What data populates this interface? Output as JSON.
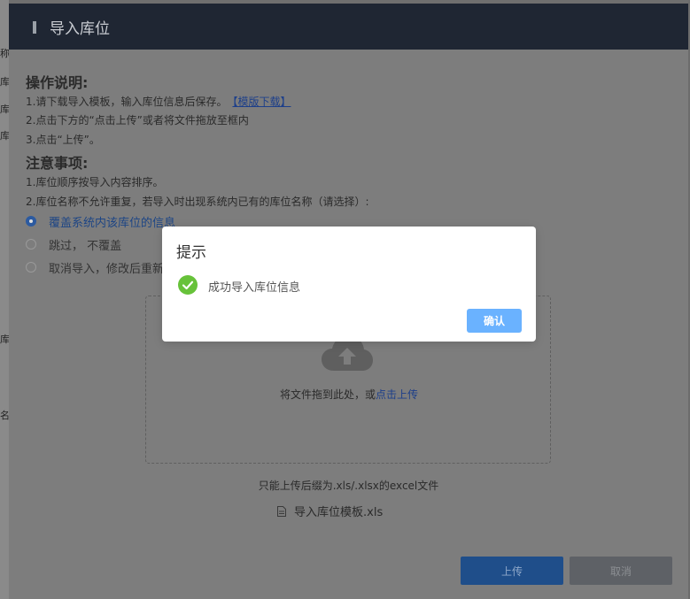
{
  "background": {
    "left_fragments": [
      "称",
      "库",
      "库",
      "库",
      "库",
      "名"
    ]
  },
  "dialog": {
    "title": "导入库位",
    "instructions": {
      "heading": "操作说明:",
      "step1": "1.请下载导入模板，输入库位信息后保存。",
      "template_link": "【模版下载】",
      "step2": "2.点击下方的“点击上传”或者将文件拖放至框内",
      "step3": "3.点击“上传”。"
    },
    "notes": {
      "heading": "注意事项:",
      "note1": "1.库位顺序按导入内容排序。",
      "note2": "2.库位名称不允许重复，若导入时出现系统内已有的库位名称（请选择）:"
    },
    "options": [
      {
        "label": "覆盖系统内该库位的信息",
        "checked": true
      },
      {
        "label": "跳过， 不覆盖",
        "checked": false
      },
      {
        "label": "取消导入，修改后重新",
        "checked": false
      }
    ],
    "dropzone": {
      "text": "将文件拖到此处，或",
      "link": "点击上传"
    },
    "upload_tip": "只能上传后缀为.xls/.xlsx的excel文件",
    "file_name": "导入库位模板.xls",
    "upload_button": "上传",
    "cancel_button": "取消"
  },
  "prompt": {
    "title": "提示",
    "message": "成功导入库位信息",
    "confirm": "确认",
    "icon": "success-check-icon"
  },
  "colors": {
    "header_bg": "#1f2633",
    "success_green": "#67c23a",
    "confirm_blue": "#6ab2ff",
    "link_blue": "#1d3f8a"
  }
}
